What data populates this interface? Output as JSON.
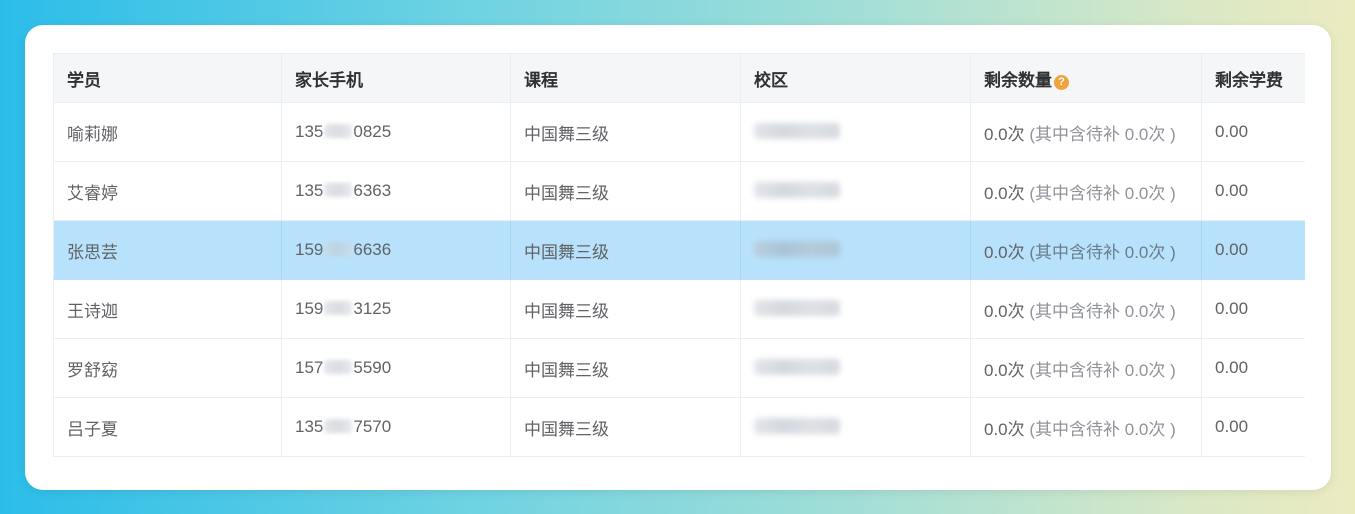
{
  "table": {
    "columns": [
      "学员",
      "家长手机",
      "课程",
      "校区",
      "剩余数量",
      "剩余学费"
    ],
    "rows": [
      {
        "student": "喻莉娜",
        "phone_prefix": "135",
        "phone_suffix": "0825",
        "course": "中国舞三级",
        "remaining": "0.0次",
        "pending": "(其中含待补 0.0次 )",
        "fee": "0.00",
        "selected": false
      },
      {
        "student": "艾睿婷",
        "phone_prefix": "135",
        "phone_suffix": "6363",
        "course": "中国舞三级",
        "remaining": "0.0次",
        "pending": "(其中含待补 0.0次 )",
        "fee": "0.00",
        "selected": false
      },
      {
        "student": "张思芸",
        "phone_prefix": "159",
        "phone_suffix": "6636",
        "course": "中国舞三级",
        "remaining": "0.0次",
        "pending": "(其中含待补 0.0次 )",
        "fee": "0.00",
        "selected": true
      },
      {
        "student": "王诗迦",
        "phone_prefix": "159",
        "phone_suffix": "3125",
        "course": "中国舞三级",
        "remaining": "0.0次",
        "pending": "(其中含待补 0.0次 )",
        "fee": "0.00",
        "selected": false
      },
      {
        "student": "罗舒窈",
        "phone_prefix": "157",
        "phone_suffix": "5590",
        "course": "中国舞三级",
        "remaining": "0.0次",
        "pending": "(其中含待补 0.0次 )",
        "fee": "0.00",
        "selected": false
      },
      {
        "student": "吕子夏",
        "phone_prefix": "135",
        "phone_suffix": "7570",
        "course": "中国舞三级",
        "remaining": "0.0次",
        "pending": "(其中含待补 0.0次 )",
        "fee": "0.00",
        "selected": false
      }
    ]
  },
  "icons": {
    "remaining_help": "question-circle-icon"
  },
  "colors": {
    "selected_row": "#b8e2fb",
    "help_icon": "#f0a23b",
    "header_bg": "#f5f6f8"
  }
}
